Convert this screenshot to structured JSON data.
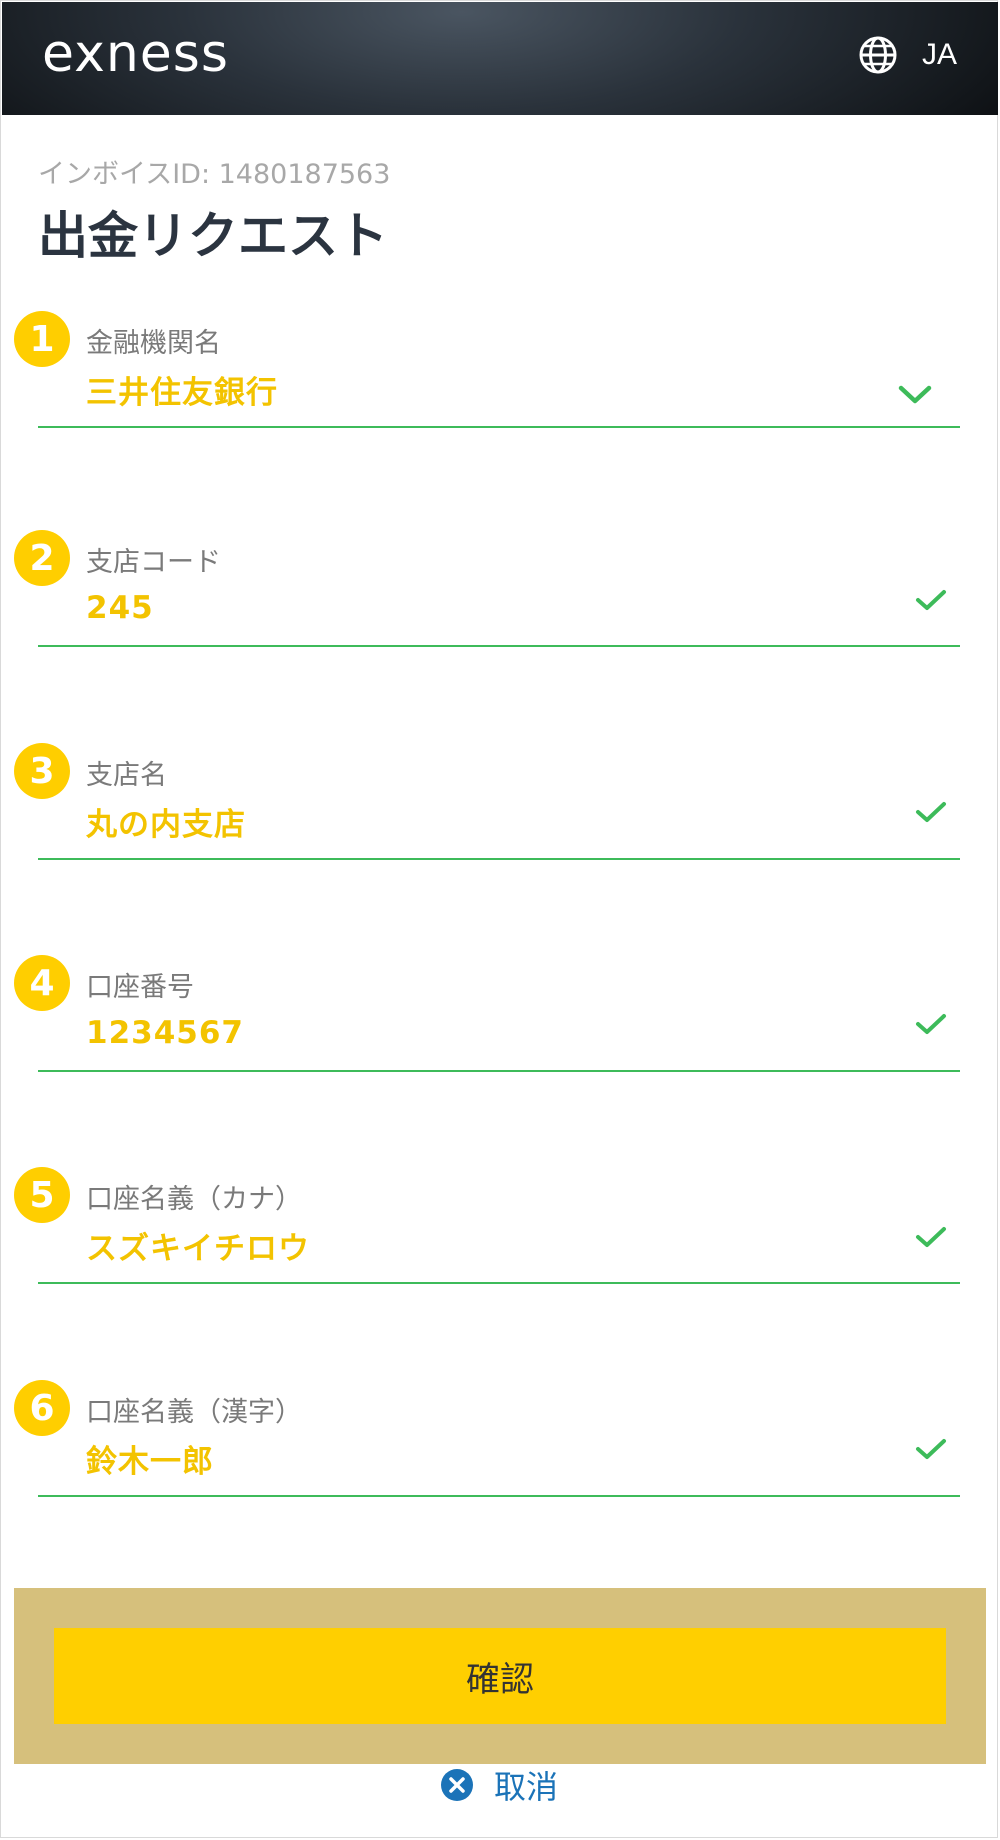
{
  "header": {
    "logo_text": "exness",
    "language": "JA",
    "language_icon": "globe-icon"
  },
  "invoice": {
    "text": "インボイスID: 1480187563"
  },
  "page": {
    "title": "出金リクエスト"
  },
  "fields": [
    {
      "step": "1",
      "label": "金融機関名",
      "value": "三井住友銀行",
      "icon": "chevron-down-icon"
    },
    {
      "step": "2",
      "label": "支店コード",
      "value": "245",
      "icon": "check-icon"
    },
    {
      "step": "3",
      "label": "支店名",
      "value": "丸の内支店",
      "icon": "check-icon"
    },
    {
      "step": "4",
      "label": "口座番号",
      "value": "1234567",
      "icon": "check-icon"
    },
    {
      "step": "5",
      "label": "口座名義（カナ）",
      "value": "スズキイチロウ",
      "icon": "check-icon"
    },
    {
      "step": "6",
      "label": "口座名義（漢字）",
      "value": "鈴木一郎",
      "icon": "check-icon"
    }
  ],
  "actions": {
    "confirm_label": "確認",
    "cancel_label": "取消",
    "cancel_icon": "close-circle-icon"
  },
  "colors": {
    "accent": "#ffce00",
    "value_text": "#f3c300",
    "valid_green": "#3dbb5a",
    "link_blue": "#1b73b8",
    "confirm_highlight": "#d6c07c"
  }
}
